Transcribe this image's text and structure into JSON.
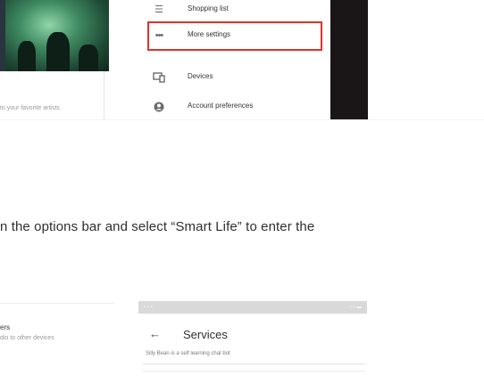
{
  "left_card": {
    "caption": "to your favorite artists"
  },
  "menu": {
    "items": [
      {
        "icon": "list-icon",
        "label": "Shopping list"
      },
      {
        "icon": "more-horizontal-icon",
        "label": "More settings",
        "highlighted": true
      },
      {
        "icon": "devices-icon",
        "label": "Devices"
      },
      {
        "icon": "account-circle-icon",
        "label": "Account preferences"
      }
    ],
    "highlight_color": "#e0322c"
  },
  "instruction": {
    "text": "n the options bar and select “Smart Life” to enter the"
  },
  "bottom_left_card": {
    "title": "ers",
    "subtitle": "dio to other devices"
  },
  "phone": {
    "title": "Services",
    "description": "Silly Bean is a self learning chat bot"
  }
}
